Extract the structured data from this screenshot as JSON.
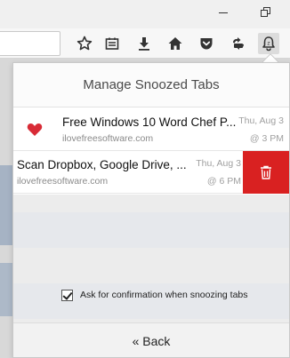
{
  "panel": {
    "title": "Manage Snoozed Tabs",
    "confirm_label": "Ask for confirmation when snoozing tabs",
    "confirm_checked": true,
    "back_label": "« Back"
  },
  "tabs": [
    {
      "title": "Free Windows 10 Word Chef P...",
      "url": "ilovefreesoftware.com",
      "date": "Thu, Aug 3",
      "time": "@ 3 PM",
      "favicon": "heart-icon"
    },
    {
      "title": "Scan Dropbox, Google Drive, ...",
      "url": "ilovefreesoftware.com",
      "date": "Thu, Aug 3",
      "time": "@ 6 PM",
      "favicon": "none"
    }
  ],
  "toolbar_icons": [
    "star-icon",
    "reader-list-icon",
    "download-icon",
    "home-icon",
    "pocket-icon",
    "sync-icon",
    "snooze-bell-icon"
  ],
  "colors": {
    "delete": "#d92121",
    "heart": "#d82b36"
  }
}
